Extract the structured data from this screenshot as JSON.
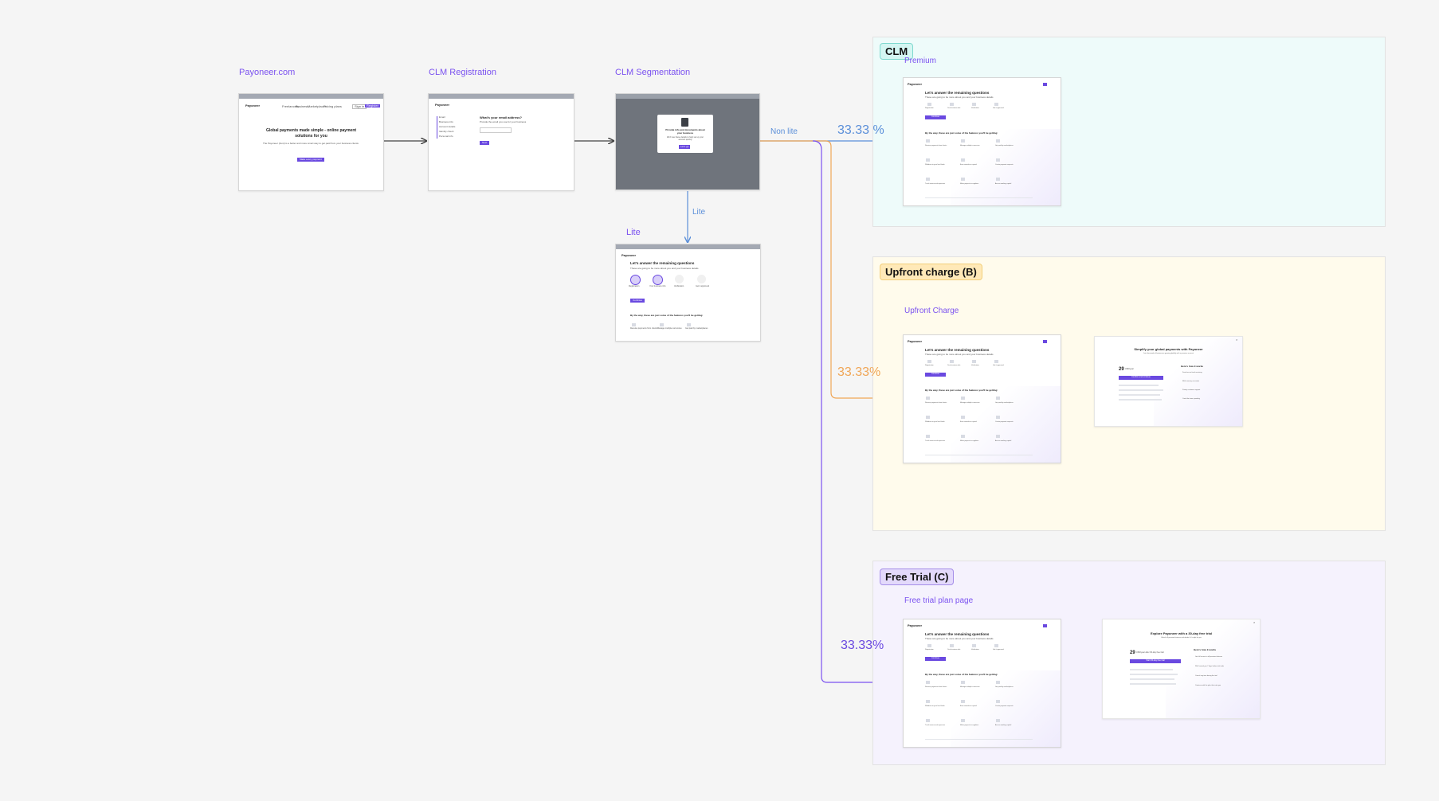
{
  "steps": {
    "payoneer": "Payoneer.com",
    "registration": "CLM Registration",
    "segmentation": "CLM Segmentation",
    "lite": "Lite"
  },
  "edges": {
    "non_lite": "Non lite",
    "lite": "Lite"
  },
  "groups": {
    "clm": {
      "tag": "CLM",
      "sub": "Premium",
      "pct": "33.33 %",
      "color": "#eefbfa",
      "tag_bg": "#d4f6f2",
      "tag_border": "#7fd9cf"
    },
    "upfront": {
      "tag": "Upfront charge (B)",
      "sub": "Upfront Charge",
      "pct": "33.33%",
      "color": "#fffbec",
      "tag_bg": "#ffe9b8",
      "tag_border": "#f2cf7a"
    },
    "trial": {
      "tag": "Free Trial (C)",
      "sub": "Free trial plan page",
      "pct": "33.33%",
      "color": "#f5f2fd",
      "tag_bg": "#e3d9fb",
      "tag_border": "#a58ee8"
    }
  },
  "colors": {
    "arrow_dark": "#444444",
    "arrow_blue": "#5b8fd9",
    "arrow_orange": "#f0a656",
    "arrow_purple": "#7b52f0",
    "pct_blue": "#5b8fd9",
    "pct_orange": "#f0a656",
    "pct_purple": "#6a49e0"
  },
  "screens": {
    "home": {
      "logo": "Payoneer",
      "nav": [
        "Freelancers",
        "Business",
        "Marketplaces",
        "Pricing plans"
      ],
      "sign_in": "Sign in",
      "register": "Register",
      "headline_1": "Global payments made simple - online payment",
      "headline_2": "solutions for you",
      "subtext": "The Payoneer (trust) is a better and more smart way to get paid from your business clients",
      "cta": "Make every payment"
    },
    "registration": {
      "logo": "Payoneer",
      "side_items": [
        "Email",
        "Business info",
        "Account details",
        "Identity check",
        "Personal info"
      ],
      "question": "What's your email address?",
      "hint": "Provide the email you use for your business",
      "next": "Next"
    },
    "segmentation": {
      "modal_title_1": "Provide info and documents about",
      "modal_title_2": "your business",
      "modal_text": "We'll use these details to help set up your account quickly",
      "modal_btn": "Let's go"
    },
    "questions": {
      "logo": "Payoneer",
      "title": "Let's answer the remaining questions",
      "subtitle": "These are going to be more about you and your business details",
      "steps": [
        "Registration",
        "Your business info",
        "Verification",
        "Get it approved"
      ],
      "continue": "Continue",
      "features_title": "By the way, these are just some of the features you'll be getting:",
      "features": [
        "Receive payments from clients",
        "Manage multiple currencies",
        "Get paid by marketplaces",
        "Withdraw to your local bank",
        "Earn rewards on spend",
        "Create payment requests",
        "Track income and expenses",
        "Make payouts to suppliers",
        "Access working capital"
      ]
    },
    "upfront_modal": {
      "title": "Simplify your global payments with Payoneer",
      "subtitle": "Join thousands of businesses growing globally with a premium account",
      "price": "29",
      "price_unit": "USD/year",
      "cta": "Confirm and continue",
      "col_title": "Here's how it works",
      "benefits": [
        "Zero fees on local receiving",
        "Multi-currency accounts",
        "Priority customer support",
        "Cards for team spending"
      ]
    },
    "trial_modal": {
      "title": "Explore Payoneer with a 30-day free trial",
      "subtitle": "Unlock all premium features and decide if it's right for you",
      "price": "29",
      "price_unit": "USD/year after 30-day free trial",
      "cta": "Start 30-day free trial",
      "col_title": "Here's how it works",
      "benefits": [
        "Get full access to all premium features",
        "We'll remind you 7 days before trial ends",
        "Cancel any time during the trial",
        "Continue with the plan that suits you"
      ]
    }
  }
}
